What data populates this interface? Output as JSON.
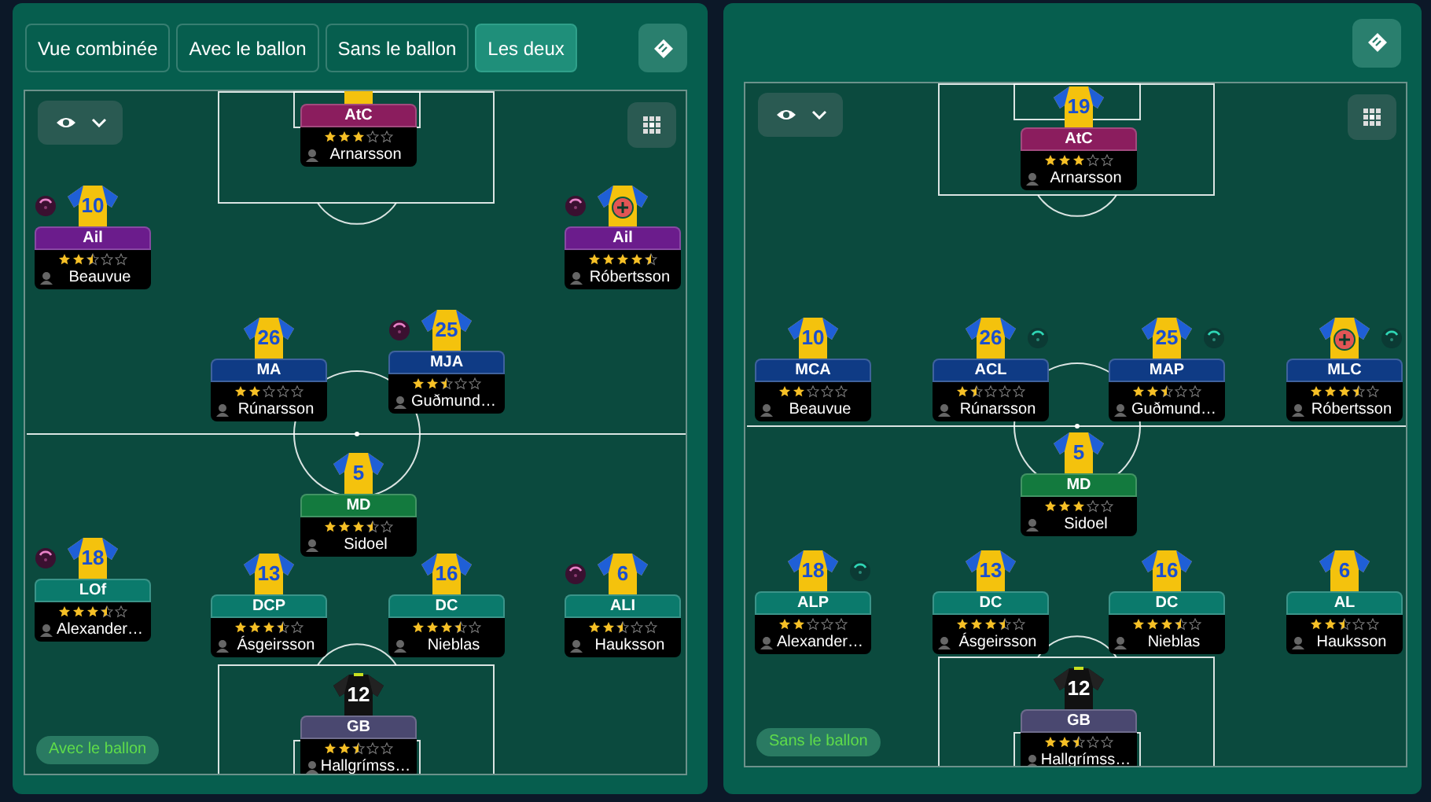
{
  "tabs": [
    {
      "label": "Vue combinée",
      "selected": false
    },
    {
      "label": "Avec le ballon",
      "selected": false
    },
    {
      "label": "Sans le ballon",
      "selected": false
    },
    {
      "label": "Les deux",
      "selected": true
    }
  ],
  "pitches": [
    {
      "phase_label": "Avec le ballon",
      "players": [
        {
          "role": "AtC",
          "color": "#8b1d5e",
          "stars": 3,
          "name": "Arnarsson",
          "goalkeeper": false,
          "injured": false,
          "marked": false
        },
        {
          "number": "10",
          "role": "Ail",
          "color": "#6b1c8c",
          "stars": 2.5,
          "name": "Beauvue",
          "goalkeeper": false,
          "injured": false,
          "marked": true
        },
        {
          "role": "Ail",
          "color": "#6b1c8c",
          "stars": 4.5,
          "name": "Róbertsson",
          "goalkeeper": false,
          "injured": true,
          "marked": true
        },
        {
          "number": "26",
          "role": "MA",
          "color": "#0f3b85",
          "stars": 2,
          "name": "Rúnarsson",
          "goalkeeper": false,
          "injured": false,
          "marked": false
        },
        {
          "number": "25",
          "role": "MJA",
          "color": "#0f3b85",
          "stars": 2.5,
          "name": "Guðmund…",
          "goalkeeper": false,
          "injured": false,
          "marked": true
        },
        {
          "number": "5",
          "role": "MD",
          "color": "#137a3e",
          "stars": 3.5,
          "name": "Sidoel",
          "goalkeeper": false,
          "injured": false,
          "marked": false
        },
        {
          "number": "18",
          "role": "LOf",
          "color": "#0b7a6c",
          "stars": 3.5,
          "name": "Alexander…",
          "goalkeeper": false,
          "injured": false,
          "marked": true
        },
        {
          "number": "13",
          "role": "DCP",
          "color": "#0b7a6c",
          "stars": 3.5,
          "name": "Ásgeirsson",
          "goalkeeper": false,
          "injured": false,
          "marked": false
        },
        {
          "number": "16",
          "role": "DC",
          "color": "#0b7a6c",
          "stars": 3.5,
          "name": "Nieblas",
          "goalkeeper": false,
          "injured": false,
          "marked": false
        },
        {
          "number": "6",
          "role": "ALI",
          "color": "#0b7a6c",
          "stars": 2.5,
          "name": "Hauksson",
          "goalkeeper": false,
          "injured": false,
          "marked": true
        },
        {
          "number": "12",
          "role": "GB",
          "color": "#4a4870",
          "stars": 2.5,
          "name": "Hallgrímss…",
          "goalkeeper": true,
          "injured": false,
          "marked": false
        }
      ]
    },
    {
      "phase_label": "Sans le ballon",
      "players": [
        {
          "number": "19",
          "role": "AtC",
          "color": "#8b1d5e",
          "stars": 3,
          "name": "Arnarsson",
          "goalkeeper": false,
          "injured": false,
          "marked": false
        },
        {
          "number": "10",
          "role": "MCA",
          "color": "#0f3b85",
          "stars": 2,
          "name": "Beauvue",
          "goalkeeper": false,
          "injured": false,
          "marked": false
        },
        {
          "number": "26",
          "role": "ACL",
          "color": "#0f3b85",
          "stars": 1.5,
          "name": "Rúnarsson",
          "goalkeeper": false,
          "injured": false,
          "marked": true
        },
        {
          "number": "25",
          "role": "MAP",
          "color": "#0f3b85",
          "stars": 2.5,
          "name": "Guðmund…",
          "goalkeeper": false,
          "injured": false,
          "marked": true
        },
        {
          "role": "MLC",
          "color": "#0f3b85",
          "stars": 3.5,
          "name": "Róbertsson",
          "goalkeeper": false,
          "injured": true,
          "marked": true
        },
        {
          "number": "5",
          "role": "MD",
          "color": "#137a3e",
          "stars": 3,
          "name": "Sidoel",
          "goalkeeper": false,
          "injured": false,
          "marked": false
        },
        {
          "number": "18",
          "role": "ALP",
          "color": "#0b7a6c",
          "stars": 2,
          "name": "Alexander…",
          "goalkeeper": false,
          "injured": false,
          "marked": true
        },
        {
          "number": "13",
          "role": "DC",
          "color": "#0b7a6c",
          "stars": 3.5,
          "name": "Ásgeirsson",
          "goalkeeper": false,
          "injured": false,
          "marked": false
        },
        {
          "number": "16",
          "role": "DC",
          "color": "#0b7a6c",
          "stars": 3.5,
          "name": "Nieblas",
          "goalkeeper": false,
          "injured": false,
          "marked": false
        },
        {
          "number": "6",
          "role": "AL",
          "color": "#0b7a6c",
          "stars": 2.5,
          "name": "Hauksson",
          "goalkeeper": false,
          "injured": false,
          "marked": false
        },
        {
          "number": "12",
          "role": "GB",
          "color": "#4a4870",
          "stars": 2.5,
          "name": "Hallgrímss…",
          "goalkeeper": true,
          "injured": false,
          "marked": false
        }
      ]
    }
  ]
}
